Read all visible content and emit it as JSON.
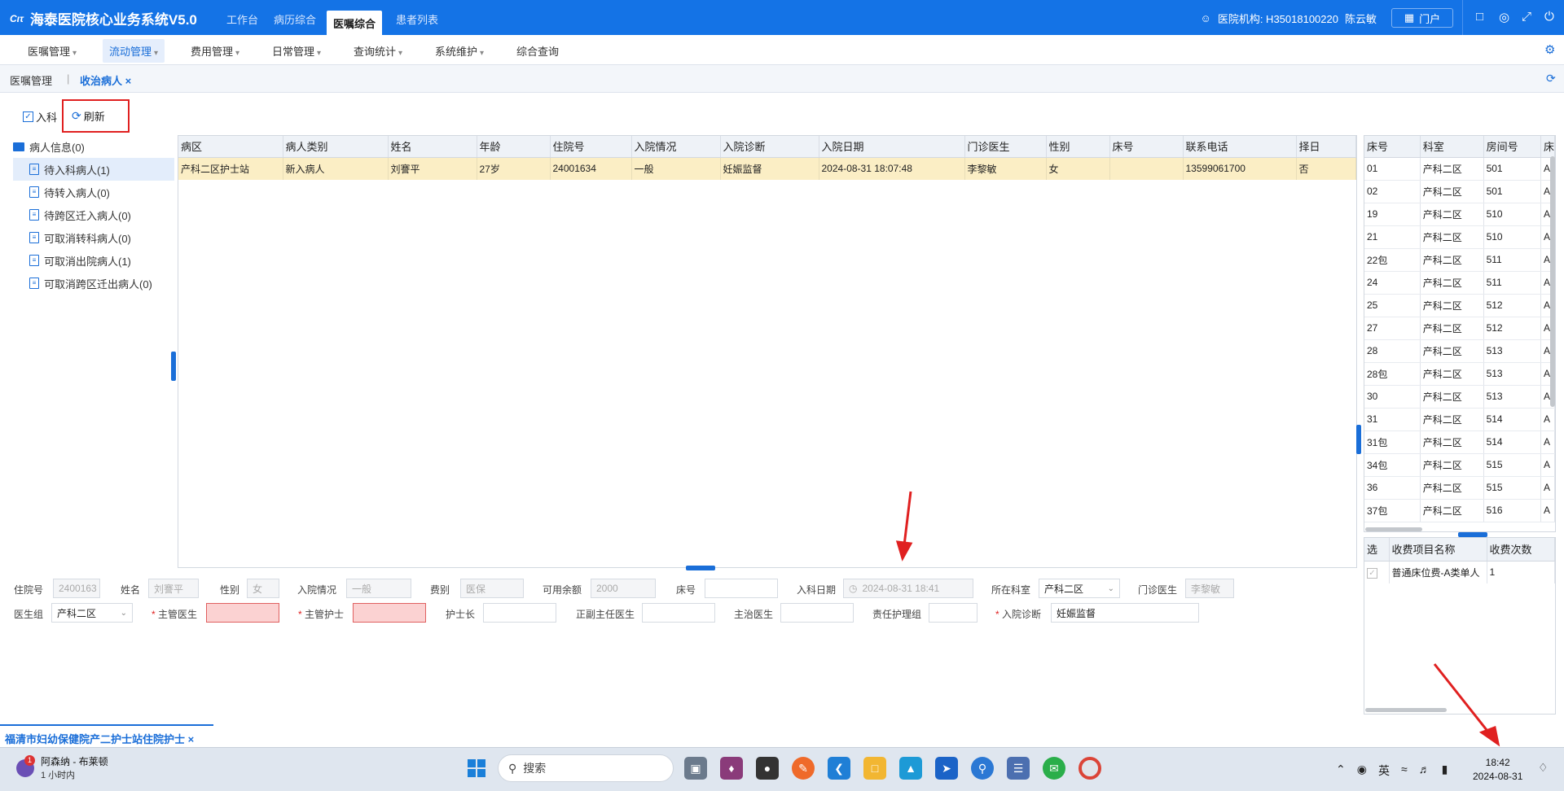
{
  "app": {
    "title": "海泰医院核心业务系统V5.0",
    "logo_mark": "Cιτ"
  },
  "nav_tabs": [
    "工作台",
    "病历综合",
    "医嘱综合",
    "患者列表"
  ],
  "header": {
    "org_label": "医院机构: H35018100220",
    "user": "陈云敏",
    "portal": "门户"
  },
  "menus": [
    "医嘱管理",
    "流动管理",
    "费用管理",
    "日常管理",
    "查询统计",
    "系统维护",
    "综合查询"
  ],
  "breadcrumb": {
    "parent": "医嘱管理",
    "current": "收治病人"
  },
  "toolbar": {
    "ruke": "入科",
    "refresh": "刷新"
  },
  "tree": {
    "root": "病人信息(0)",
    "items": [
      "待入科病人(1)",
      "待转入病人(0)",
      "待跨区迁入病人(0)",
      "可取消转科病人(0)",
      "可取消出院病人(1)",
      "可取消跨区迁出病人(0)"
    ]
  },
  "patient_grid": {
    "columns": [
      "病区",
      "病人类别",
      "姓名",
      "年龄",
      "住院号",
      "入院情况",
      "入院诊断",
      "入院日期",
      "门诊医生",
      "性别",
      "床号",
      "联系电话",
      "择日"
    ],
    "rows": [
      [
        "产科二区护士站",
        "新入病人",
        "刘謇平",
        "27岁",
        "24001634",
        "一般",
        "妊娠监督",
        "2024-08-31 18:07:48",
        "李黎敏",
        "女",
        "",
        "13599061700",
        "否"
      ]
    ]
  },
  "bed_grid": {
    "columns": [
      "床号",
      "科室",
      "房间号",
      "床"
    ],
    "rows": [
      [
        "01",
        "产科二区",
        "501",
        "A"
      ],
      [
        "02",
        "产科二区",
        "501",
        "A"
      ],
      [
        "19",
        "产科二区",
        "510",
        "A"
      ],
      [
        "21",
        "产科二区",
        "510",
        "A"
      ],
      [
        "22包",
        "产科二区",
        "511",
        "A"
      ],
      [
        "24",
        "产科二区",
        "511",
        "A"
      ],
      [
        "25",
        "产科二区",
        "512",
        "A"
      ],
      [
        "27",
        "产科二区",
        "512",
        "A"
      ],
      [
        "28",
        "产科二区",
        "513",
        "A"
      ],
      [
        "28包",
        "产科二区",
        "513",
        "A"
      ],
      [
        "30",
        "产科二区",
        "513",
        "A"
      ],
      [
        "31",
        "产科二区",
        "514",
        "A"
      ],
      [
        "31包",
        "产科二区",
        "514",
        "A"
      ],
      [
        "34包",
        "产科二区",
        "515",
        "A"
      ],
      [
        "36",
        "产科二区",
        "515",
        "A"
      ],
      [
        "37包",
        "产科二区",
        "516",
        "A"
      ]
    ]
  },
  "fee_grid": {
    "columns": [
      "选",
      "收费项目名称",
      "收费次数"
    ],
    "rows": [
      [
        "✓",
        "普通床位费-A类单人",
        "1"
      ]
    ]
  },
  "form": {
    "zyh_label": "住院号",
    "zyh": "2400163",
    "name_label": "姓名",
    "name": "刘謇平",
    "sex_label": "性别",
    "sex": "女",
    "rycond_label": "入院情况",
    "rycond": "一般",
    "feetype_label": "费别",
    "feetype": "医保",
    "balance_label": "可用余额",
    "balance": "2000",
    "bed_label": "床号",
    "bed": "",
    "rkdate_label": "入科日期",
    "rkdate": "2024-08-31 18:41",
    "dept_label": "所在科室",
    "dept": "产科二区",
    "mzdoc_label": "门诊医生",
    "mzdoc": "李黎敏",
    "group_label": "医生组",
    "group": "产科二区",
    "zgdoc_label": "主管医生",
    "zgnurse_label": "主管护士",
    "hsz_label": "护士长",
    "zfzr_label": "正副主任医生",
    "zzys_label": "主治医生",
    "zrhl_label": "责任护理组",
    "rydiag_label": "入院诊断",
    "rydiag": "妊娠监督"
  },
  "status_tab": "福清市妇幼保健院产二护士站住院护士",
  "taskbar": {
    "weather_title": "阿森纳 - 布莱顿",
    "weather_sub": "1 小时内",
    "badge": "1",
    "search": "搜索",
    "tray_ime": "英",
    "time": "18:42",
    "date": "2024-08-31"
  },
  "colors": {
    "brand": "#1473e6",
    "highlight_row": "#fbeec5",
    "error_field": "#fbd2d2",
    "annotation": "#e02020"
  }
}
